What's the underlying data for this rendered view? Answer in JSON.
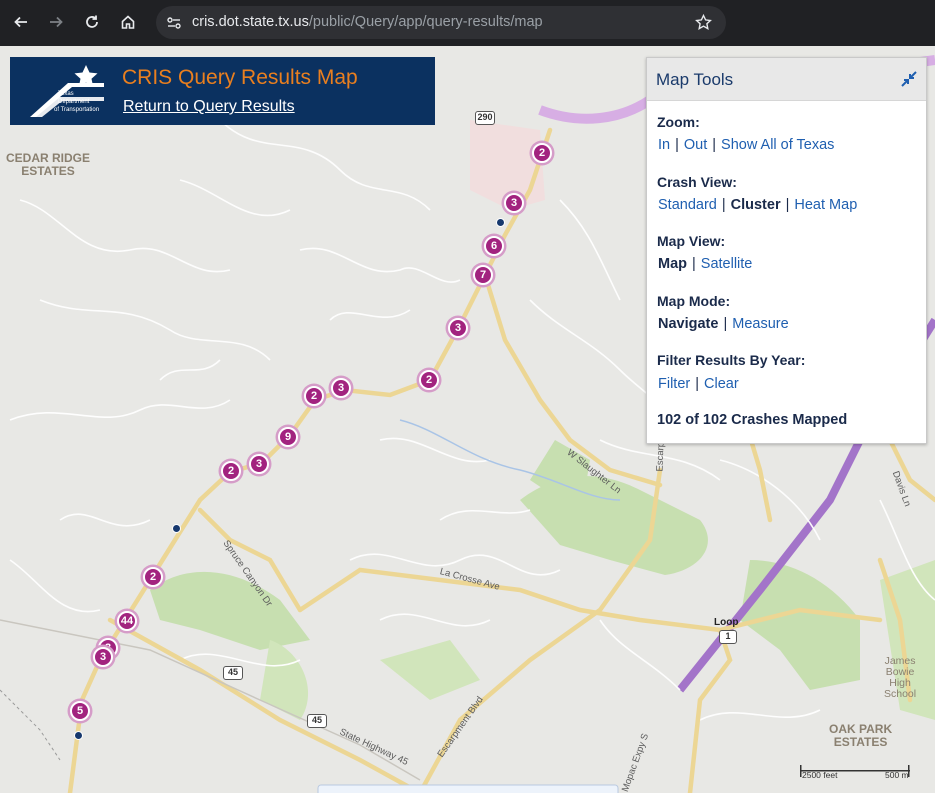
{
  "browser": {
    "url_host": "cris.dot.state.tx.us",
    "url_path": "/public/Query/app/query-results/map"
  },
  "header": {
    "logo_text_1": "Texas",
    "logo_text_2": "Department",
    "logo_text_3": "of Transportation",
    "title": "CRIS Query Results Map",
    "return_link": "Return to Query Results"
  },
  "tools": {
    "title": "Map Tools",
    "zoom_label": "Zoom:",
    "zoom_in": "In",
    "zoom_out": "Out",
    "zoom_all": "Show All of Texas",
    "crash_view_label": "Crash View:",
    "crash_standard": "Standard",
    "crash_cluster": "Cluster",
    "crash_heat": "Heat Map",
    "map_view_label": "Map View:",
    "map_view_map": "Map",
    "map_view_satellite": "Satellite",
    "map_mode_label": "Map Mode:",
    "map_mode_navigate": "Navigate",
    "map_mode_measure": "Measure",
    "filter_label": "Filter Results By Year:",
    "filter_filter": "Filter",
    "filter_clear": "Clear",
    "count_text": "102 of 102 Crashes Mapped"
  },
  "map": {
    "labels": {
      "cedar_1": "CEDAR RIDGE",
      "cedar_2": "ESTATES",
      "oak_1": "OAK PARK",
      "oak_2": "ESTATES",
      "james_1": "James",
      "james_2": "Bowie",
      "james_3": "High",
      "james_4": "School",
      "loop": "Loop"
    },
    "shields": {
      "s290": "290",
      "s1": "1",
      "s45a": "45",
      "s45b": "45"
    },
    "roads": {
      "slaughter": "W Slaughter Ln",
      "escarpment": "Escarpment Blvd",
      "escarpment2": "Escarpment Blvd",
      "lacrosse": "La Crosse Ave",
      "spruce": "Spruce Canyon Dr",
      "sh45": "State Highway 45",
      "mopac": "Mopac Expy S",
      "davis": "Davis Ln"
    },
    "scale_feet": "2500 feet",
    "scale_m": "500 m",
    "clusters": [
      {
        "n": "2"
      },
      {
        "n": "3"
      },
      {
        "n": "6"
      },
      {
        "n": "7"
      },
      {
        "n": "3"
      },
      {
        "n": "2"
      },
      {
        "n": "3"
      },
      {
        "n": "2"
      },
      {
        "n": "9"
      },
      {
        "n": "3"
      },
      {
        "n": "2"
      },
      {
        "n": "2"
      },
      {
        "n": "44"
      },
      {
        "n": "3"
      },
      {
        "n": "3"
      },
      {
        "n": "5"
      }
    ]
  }
}
